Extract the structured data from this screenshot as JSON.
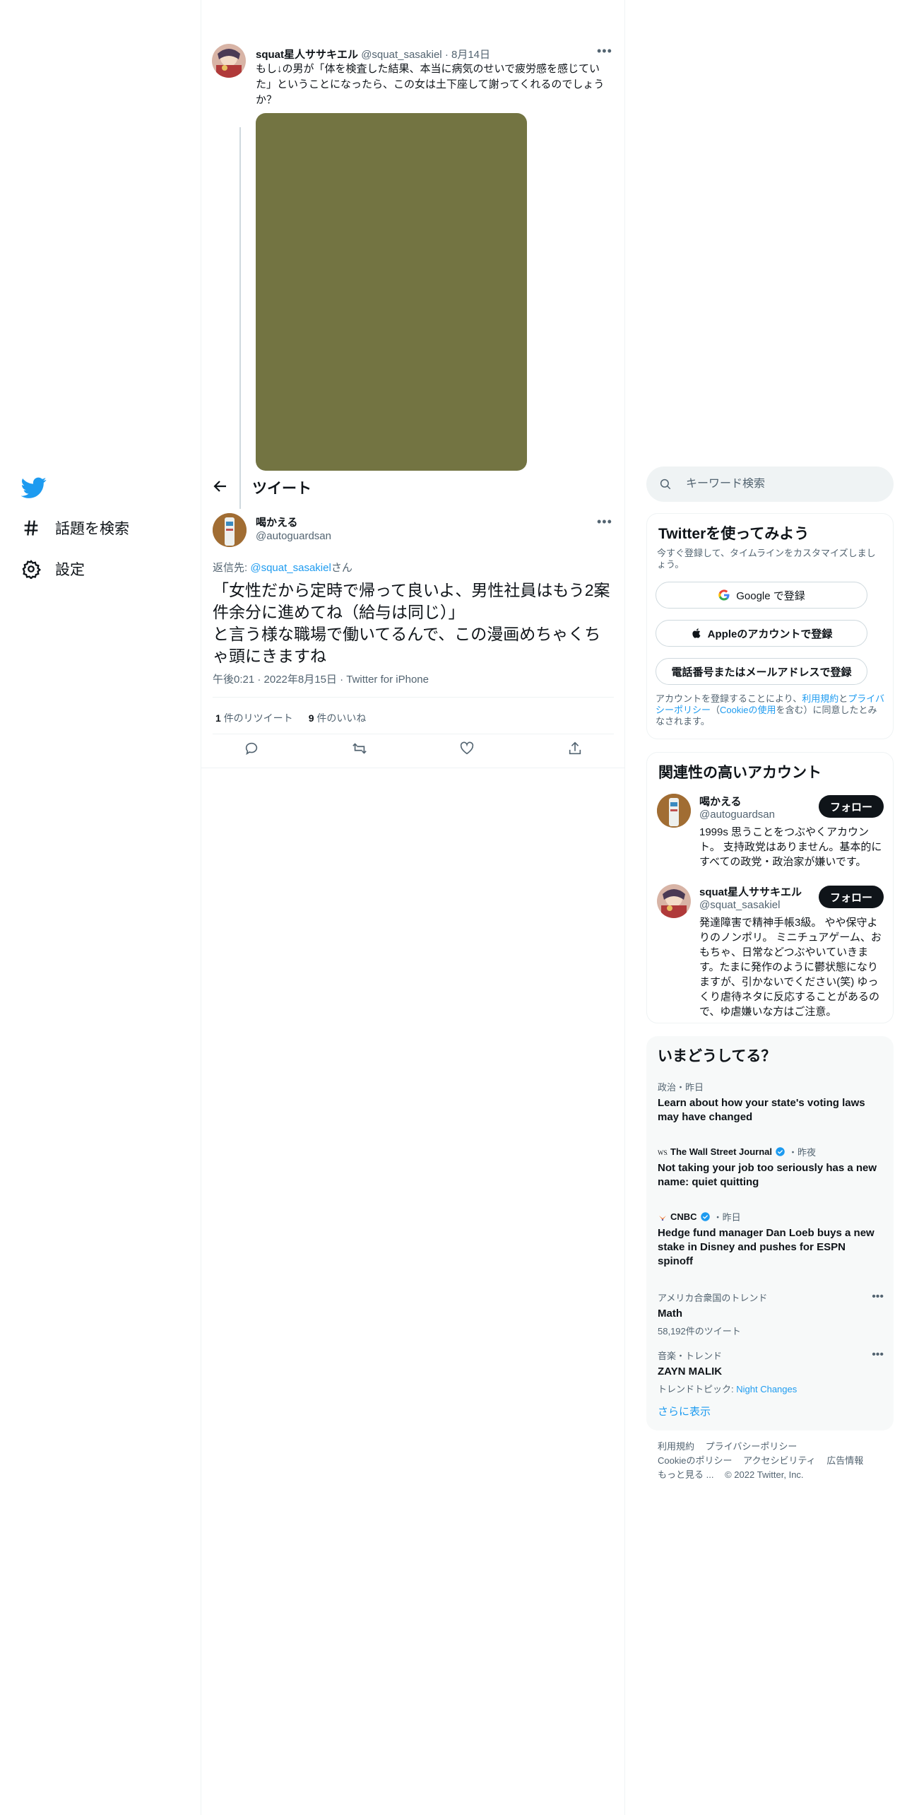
{
  "nav": {
    "explore_label": "話題を検索",
    "settings_label": "設定"
  },
  "parent_tweet": {
    "name": "squat星人ササキエル",
    "handle": "@squat_sasakiel",
    "date": "8月14日",
    "text": "もし↓の男が「体を検査した結果、本当に病気のせいで疲労感を感じていた」ということになったら、この女は土下座して謝ってくれるのでしょうか？"
  },
  "header": {
    "title": "ツイート"
  },
  "main_tweet": {
    "name": "喝かえる",
    "handle": "@autoguardsan",
    "reply_prefix": "返信先: ",
    "reply_to": "@squat_sasakiel",
    "reply_suffix": "さん",
    "text_line1": "「女性だから定時で帰って良いよ、男性社員はもう2案件余分に進めてね（給与は同じ）」",
    "text_line2": "と言う様な職場で働いてるんで、この漫画めちゃくちゃ頭にきますね",
    "timestamp": "午後0:21 · 2022年8月15日 · Twitter for iPhone",
    "retweet_count": "1",
    "retweet_label": "件のリツイート",
    "like_count": "9",
    "like_label": "件のいいね"
  },
  "search": {
    "placeholder": "キーワード検索"
  },
  "signup": {
    "title": "Twitterを使ってみよう",
    "subtitle": "今すぐ登録して、タイムラインをカスタマイズしましょう。",
    "google_label": "Google で登録",
    "apple_label": "Appleのアカウントで登録",
    "phone_label": "電話番号またはメールアドレスで登録",
    "terms_prefix": "アカウントを登録することにより、",
    "terms_link": "利用規約",
    "terms_and": "と",
    "privacy_link": "プライバシーポリシー",
    "cookie_open": "（",
    "cookie_link": "Cookieの使用",
    "terms_suffix": "を含む）に同意したとみなされます。"
  },
  "relevant": {
    "title": "関連性の高いアカウント",
    "follow_label": "フォロー",
    "accounts": [
      {
        "name": "喝かえる",
        "handle": "@autoguardsan",
        "bio": "1999s 思うことをつぶやくアカウント。 支持政党はありません。基本的にすべての政党・政治家が嫌いです。"
      },
      {
        "name": "squat星人ササキエル",
        "handle": "@squat_sasakiel",
        "bio": "発達障害で精神手帳3級。 やや保守よりのノンポリ。 ミニチュアゲーム、おもちゃ、日常などつぶやいていきます。たまに発作のように鬱状態になりますが、引かないでください(笑) ゆっくり虐待ネタに反応することがあるので、ゆ虐嫌いな方はご注意。"
      }
    ]
  },
  "trends": {
    "title": "いまどうしてる？",
    "items": [
      {
        "category": "政治・昨日",
        "title": "Learn about how your state's voting laws may have changed"
      },
      {
        "source": "The Wall Street Journal",
        "time": "・昨夜",
        "title": "Not taking your job too seriously has a new name: quiet quitting"
      },
      {
        "source": "CNBC",
        "time": "・昨日",
        "title": "Hedge fund manager Dan Loeb buys a new stake in Disney and pushes for ESPN spinoff"
      },
      {
        "category": "アメリカ合衆国のトレンド",
        "title": "Math",
        "sub": "58,192件のツイート"
      },
      {
        "category": "音楽・トレンド",
        "title": "ZAYN MALIK",
        "sub_prefix": "トレンドトピック: ",
        "sub_link": "Night Changes"
      }
    ],
    "show_more": "さらに表示"
  },
  "footer": {
    "terms": "利用規約",
    "privacy": "プライバシーポリシー",
    "cookie": "Cookieのポリシー",
    "accessibility": "アクセシビリティ",
    "ads": "広告情報",
    "more": "もっと見る ...",
    "copyright": "© 2022 Twitter, Inc."
  },
  "colors": {
    "accent": "#1d9bf0",
    "text": "#0f1419",
    "muted": "#536471",
    "media_placeholder": "#737442"
  }
}
